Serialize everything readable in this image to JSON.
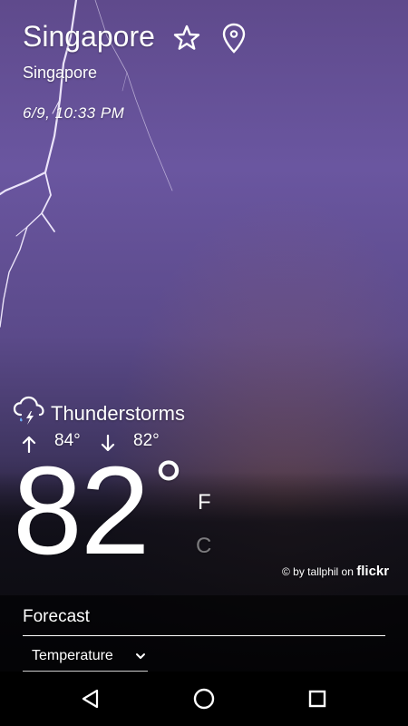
{
  "header": {
    "city": "Singapore",
    "region": "Singapore",
    "datetime": "6/9, 10:33 PM",
    "favorite_icon": "star-outline-icon",
    "location_icon": "map-pin-icon"
  },
  "current": {
    "condition_icon": "thunderstorm-icon",
    "condition": "Thunderstorms",
    "high": "84°",
    "low": "82°",
    "temperature": "82",
    "degree_symbol": "°",
    "unit_f": "F",
    "unit_c": "C",
    "active_unit": "F"
  },
  "credit": {
    "prefix": "© by tallphil on",
    "brand": "flickr"
  },
  "forecast": {
    "title": "Forecast",
    "selected_metric": "Temperature"
  },
  "navbar": {
    "back_icon": "back-triangle-icon",
    "home_icon": "home-circle-icon",
    "recents_icon": "recents-square-icon"
  },
  "colors": {
    "sky_top": "#5f4a8c",
    "sky_mid": "#6a56a0",
    "text": "#ffffff",
    "navbar": "#000000"
  }
}
